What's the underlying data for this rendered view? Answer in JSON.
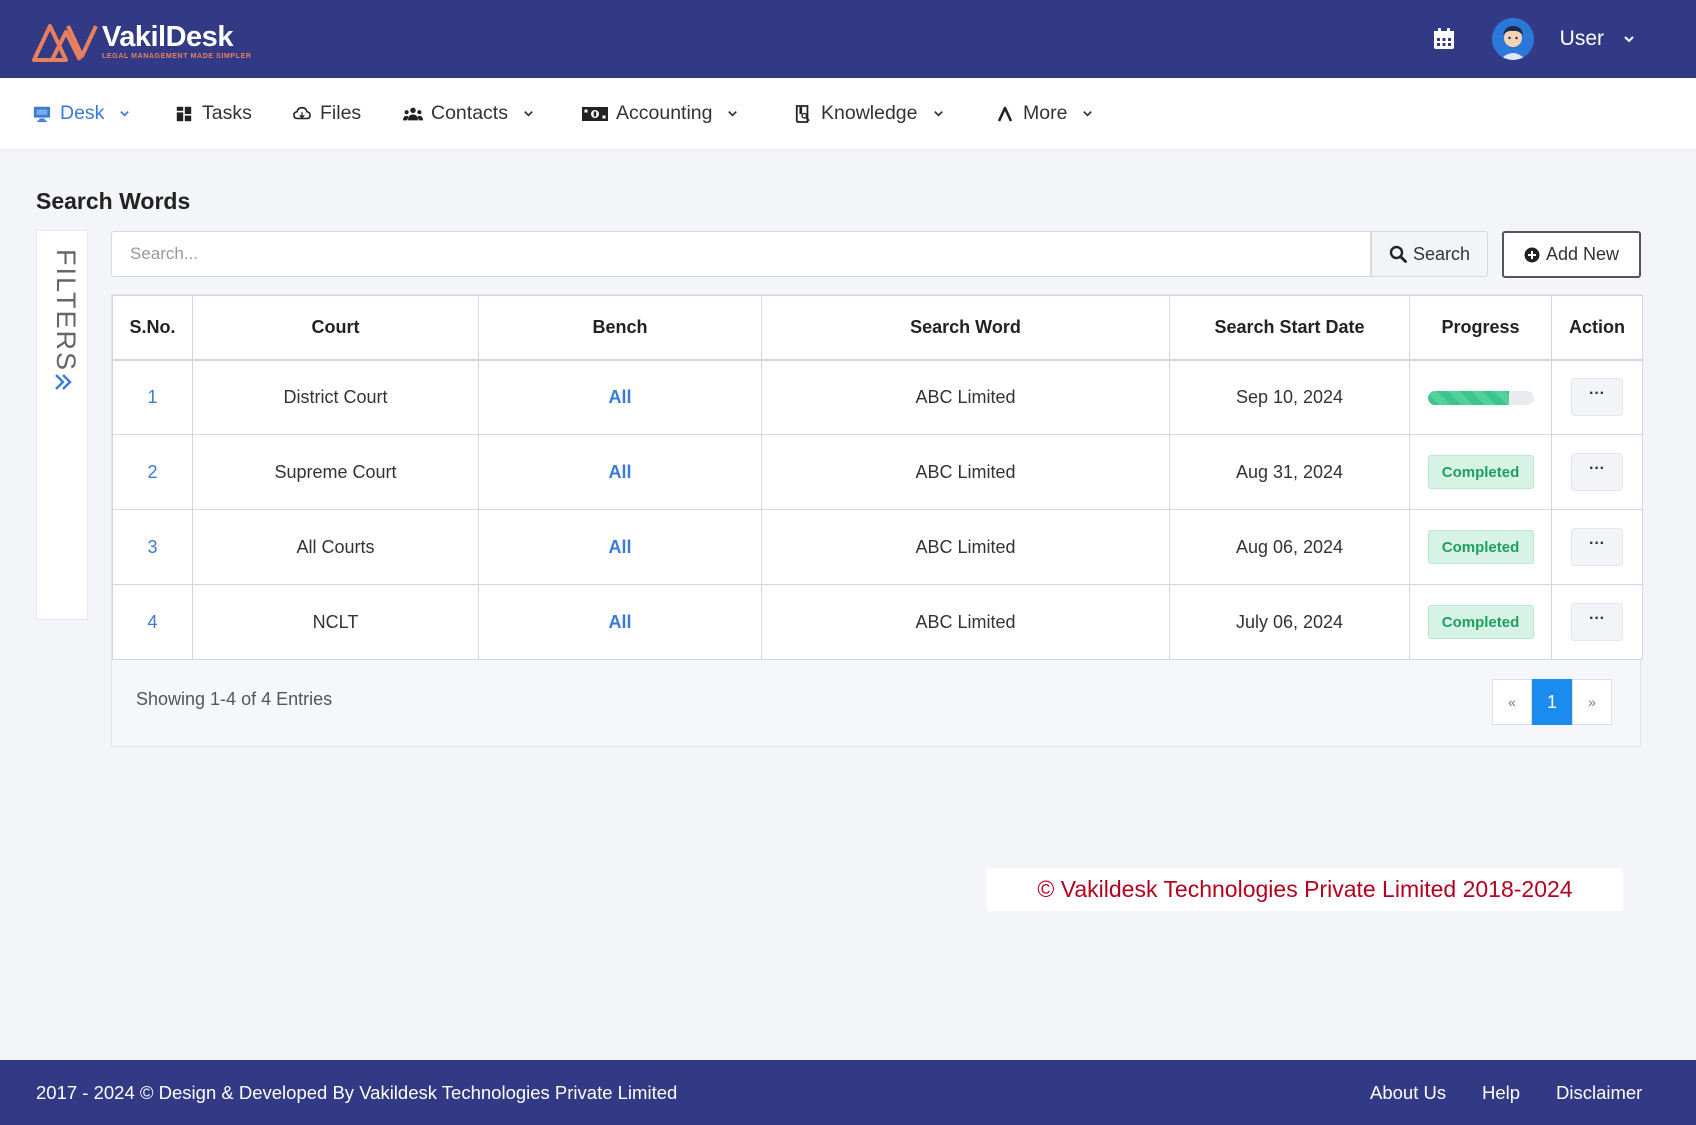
{
  "brand": {
    "name": "VakilDesk",
    "tagline": "LEGAL MANAGEMENT MADE SIMPLER",
    "accent": "#e8805e",
    "header_bg": "#333a85"
  },
  "header": {
    "user_label": "User",
    "icons": [
      "calendar-icon",
      "avatar",
      "chevron-down-icon"
    ]
  },
  "nav": {
    "items": [
      {
        "label": "Desk",
        "icon": "desktop-icon",
        "dropdown": true,
        "active": true
      },
      {
        "label": "Tasks",
        "icon": "grid-icon",
        "dropdown": false
      },
      {
        "label": "Files",
        "icon": "cloud-icon",
        "dropdown": false
      },
      {
        "label": "Contacts",
        "icon": "users-icon",
        "dropdown": true
      },
      {
        "label": "Accounting",
        "icon": "money-icon",
        "dropdown": true
      },
      {
        "label": "Knowledge",
        "icon": "book-icon",
        "dropdown": true
      },
      {
        "label": "More",
        "icon": "caret-up-icon",
        "dropdown": true
      }
    ]
  },
  "page": {
    "title": "Search Words",
    "filters_label": "FILTERS",
    "search_placeholder": "Search...",
    "search_button": "Search",
    "add_new_button": "Add New"
  },
  "table": {
    "columns": [
      "S.No.",
      "Court",
      "Bench",
      "Search Word",
      "Search Start Date",
      "Progress",
      "Action"
    ],
    "rows": [
      {
        "sno": "1",
        "court": "District Court",
        "bench": "All",
        "search_word": "ABC Limited",
        "start_date": "Sep 10, 2024",
        "progress_type": "bar",
        "progress_percent": 77,
        "action": "···"
      },
      {
        "sno": "2",
        "court": "Supreme Court",
        "bench": "All",
        "search_word": "ABC Limited",
        "start_date": "Aug 31, 2024",
        "progress_type": "badge",
        "status": "Completed",
        "action": "···"
      },
      {
        "sno": "3",
        "court": "All Courts",
        "bench": "All",
        "search_word": "ABC Limited",
        "start_date": "Aug 06, 2024",
        "progress_type": "badge",
        "status": "Completed",
        "action": "···"
      },
      {
        "sno": "4",
        "court": "NCLT",
        "bench": "All",
        "search_word": "ABC Limited",
        "start_date": "July 06, 2024",
        "progress_type": "badge",
        "status": "Completed",
        "action": "···"
      }
    ],
    "summary": "Showing 1-4 of 4 Entries",
    "pagination": {
      "prev": "«",
      "current": "1",
      "next": "»"
    }
  },
  "copyright_notice": "© Vakildesk Technologies Private Limited 2018-2024",
  "footer": {
    "text": "2017 - 2024 © Design & Developed By Vakildesk Technologies Private Limited",
    "links": [
      "About Us",
      "Help",
      "Disclaimer"
    ]
  }
}
